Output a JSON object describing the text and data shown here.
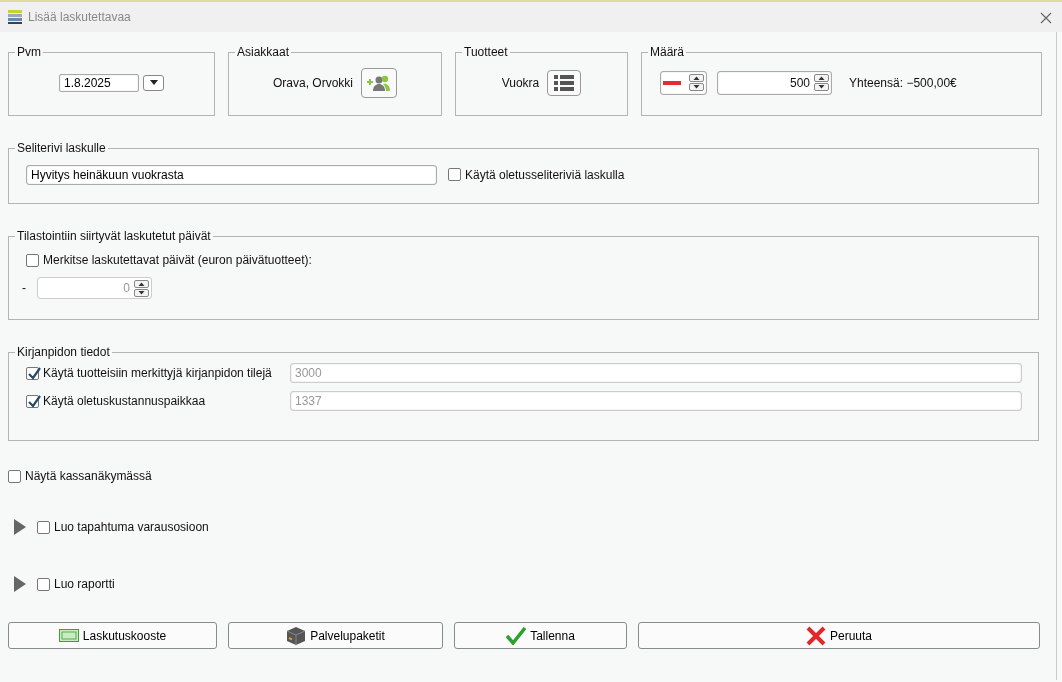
{
  "window": {
    "title": "Lisää laskutettavaa"
  },
  "date": {
    "legend": "Pvm",
    "value": "1.8.2025"
  },
  "customers": {
    "legend": "Asiakkaat",
    "value": "Orava, Orvokki"
  },
  "products": {
    "legend": "Tuotteet",
    "value": "Vuokra"
  },
  "quantity": {
    "legend": "Määrä",
    "negative": true,
    "value": "500",
    "total": "Yhteensä: −500,00€"
  },
  "description": {
    "legend": "Seliterivi laskulle",
    "value": "Hyvitys heinäkuun vuokrasta",
    "default_option": {
      "label": "Käytä oletusseliteriviä laskulla",
      "checked": false
    }
  },
  "statistics": {
    "legend": "Tilastointiin siirtyvät laskutetut päivät",
    "option": {
      "label": "Merkitse laskutettavat päivät (euron päivätuotteet):",
      "checked": false
    },
    "prefix": "-",
    "days": {
      "value": "0",
      "disabled": true
    }
  },
  "accounting": {
    "legend": "Kirjanpidon tiedot",
    "rows": [
      {
        "label": "Käytä tuotteisiin merkittyjä kirjanpidon tilejä",
        "checked": true,
        "value": "3000",
        "disabled": true
      },
      {
        "label": "Käytä oletuskustannuspaikkaa",
        "checked": true,
        "value": "1337",
        "disabled": true
      }
    ]
  },
  "show_in_register": {
    "label": "Näytä kassanäkymässä",
    "checked": false
  },
  "expanders": [
    {
      "label": "Luo tapahtuma varausosioon",
      "expanded": false,
      "checked": false
    },
    {
      "label": "Luo raportti",
      "expanded": false,
      "checked": false
    }
  ],
  "buttons": [
    {
      "kind": "summary",
      "label": "Laskutuskooste"
    },
    {
      "kind": "packages",
      "label": "Palvelupaketit"
    },
    {
      "kind": "save",
      "label": "Tallenna"
    },
    {
      "kind": "cancel",
      "label": "Peruuta"
    }
  ]
}
